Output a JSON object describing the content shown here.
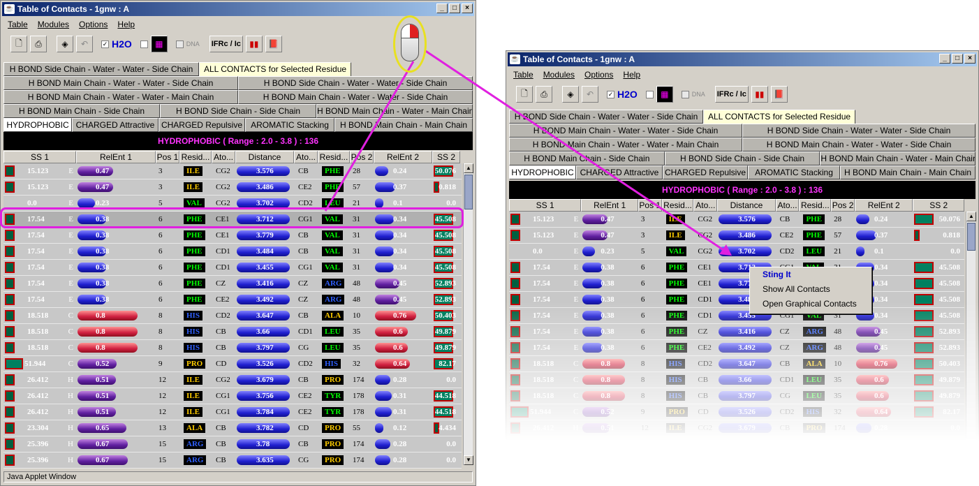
{
  "window": {
    "title": "Table of Contacts - 1gnw : A",
    "app_icon": "java-cup-icon"
  },
  "menu": [
    "Table",
    "Modules",
    "Options",
    "Help"
  ],
  "toolbar": {
    "h2o_label": "H2O",
    "dna_label": "DNA",
    "ifrc_label": "IFRc / Ic"
  },
  "tabs": {
    "row1": [
      "H BOND Side Chain - Water - Water - Side Chain",
      "ALL CONTACTS for Selected Residue"
    ],
    "row2": [
      "H BOND Main Chain - Water - Water - Side Chain",
      "H BOND Side Chain - Water - Water - Side Chain"
    ],
    "row3": [
      "H BOND Main Chain - Water - Water - Main Chain",
      "H BOND Main Chain - Water - Water - Side Chain"
    ],
    "row4": [
      "H BOND Main Chain - Side Chain",
      "H BOND Side Chain - Side Chain",
      "H BOND Main Chain - Water - Main Chain"
    ],
    "row5": [
      "HYDROPHOBIC",
      "CHARGED Attractive",
      "CHARGED Repulsive",
      "AROMATIC Stacking",
      "H BOND Main Chain - Main Chain"
    ]
  },
  "panel_title": "HYDROPHOBIC ( Range :  2.0 - 3.8 ) :  136",
  "columns": [
    "SS 1",
    "RelEnt 1",
    "Pos 1",
    "Resid...",
    "Ato...",
    "Distance",
    "Ato...",
    "Resid...",
    "Pos 2",
    "RelEnt 2",
    "SS 2"
  ],
  "columns_left": [
    "SS 1",
    "RelEnt 1",
    "Pos 1",
    "Resid...",
    "Ato...",
    "Distance",
    "Ato...",
    "Resid...",
    "Pos 2",
    "RelEnt 2",
    "SS 2"
  ],
  "rows": [
    {
      "ss1": "15.123",
      "e": "E",
      "rel1": "0.47",
      "pos1": "3",
      "res1": "ILE",
      "ato1": "CG2",
      "dist": "3.576",
      "ato2": "CB",
      "res2": "PHE",
      "pos2": "28",
      "rel2": "0.24",
      "ss2": "50.076"
    },
    {
      "ss1": "15.123",
      "e": "E",
      "rel1": "0.47",
      "pos1": "3",
      "res1": "ILE",
      "ato1": "CG2",
      "dist": "3.486",
      "ato2": "CE2",
      "res2": "PHE",
      "pos2": "57",
      "rel2": "0.37",
      "ss2": "0.818"
    },
    {
      "ss1": "0.0",
      "e": "E",
      "rel1": "0.23",
      "pos1": "5",
      "res1": "VAL",
      "ato1": "CG2",
      "dist": "3.702",
      "ato2": "CD2",
      "res2": "LEU",
      "pos2": "21",
      "rel2": "0.1",
      "ss2": "0.0"
    },
    {
      "ss1": "17.54",
      "e": "E",
      "rel1": "0.38",
      "pos1": "6",
      "res1": "PHE",
      "ato1": "CE1",
      "dist": "3.712",
      "ato2": "CG1",
      "res2": "VAL",
      "pos2": "31",
      "rel2": "0.34",
      "ss2": "45.508"
    },
    {
      "ss1": "17.54",
      "e": "E",
      "rel1": "0.38",
      "pos1": "6",
      "res1": "PHE",
      "ato1": "CE1",
      "dist": "3.779",
      "ato2": "CB",
      "res2": "VAL",
      "pos2": "31",
      "rel2": "0.34",
      "ss2": "45.508"
    },
    {
      "ss1": "17.54",
      "e": "E",
      "rel1": "0.38",
      "pos1": "6",
      "res1": "PHE",
      "ato1": "CD1",
      "dist": "3.484",
      "ato2": "CB",
      "res2": "VAL",
      "pos2": "31",
      "rel2": "0.34",
      "ss2": "45.508"
    },
    {
      "ss1": "17.54",
      "e": "E",
      "rel1": "0.38",
      "pos1": "6",
      "res1": "PHE",
      "ato1": "CD1",
      "dist": "3.455",
      "ato2": "CG1",
      "res2": "VAL",
      "pos2": "31",
      "rel2": "0.34",
      "ss2": "45.508"
    },
    {
      "ss1": "17.54",
      "e": "E",
      "rel1": "0.38",
      "pos1": "6",
      "res1": "PHE",
      "ato1": "CZ",
      "dist": "3.416",
      "ato2": "CZ",
      "res2": "ARG",
      "pos2": "48",
      "rel2": "0.45",
      "ss2": "52.893"
    },
    {
      "ss1": "17.54",
      "e": "E",
      "rel1": "0.38",
      "pos1": "6",
      "res1": "PHE",
      "ato1": "CE2",
      "dist": "3.492",
      "ato2": "CZ",
      "res2": "ARG",
      "pos2": "48",
      "rel2": "0.45",
      "ss2": "52.893"
    },
    {
      "ss1": "18.518",
      "e": "C",
      "rel1": "0.8",
      "pos1": "8",
      "res1": "HIS",
      "ato1": "CD2",
      "dist": "3.647",
      "ato2": "CB",
      "res2": "ALA",
      "pos2": "10",
      "rel2": "0.76",
      "ss2": "50.403"
    },
    {
      "ss1": "18.518",
      "e": "C",
      "rel1": "0.8",
      "pos1": "8",
      "res1": "HIS",
      "ato1": "CB",
      "dist": "3.66",
      "ato2": "CD1",
      "res2": "LEU",
      "pos2": "35",
      "rel2": "0.6",
      "ss2": "49.879"
    },
    {
      "ss1": "18.518",
      "e": "C",
      "rel1": "0.8",
      "pos1": "8",
      "res1": "HIS",
      "ato1": "CB",
      "dist": "3.797",
      "ato2": "CG",
      "res2": "LEU",
      "pos2": "35",
      "rel2": "0.6",
      "ss2": "49.879"
    },
    {
      "ss1": "51.944",
      "e": "C",
      "rel1": "0.52",
      "pos1": "9",
      "res1": "PRO",
      "ato1": "CD",
      "dist": "3.526",
      "ato2": "CD2",
      "res2": "HIS",
      "pos2": "32",
      "rel2": "0.64",
      "ss2": "82.17"
    },
    {
      "ss1": "26.412",
      "e": "H",
      "rel1": "0.51",
      "pos1": "12",
      "res1": "ILE",
      "ato1": "CG2",
      "dist": "3.679",
      "ato2": "CB",
      "res2": "PRO",
      "pos2": "174",
      "rel2": "0.28",
      "ss2": "0.0"
    },
    {
      "ss1": "26.412",
      "e": "H",
      "rel1": "0.51",
      "pos1": "12",
      "res1": "ILE",
      "ato1": "CG1",
      "dist": "3.756",
      "ato2": "CE2",
      "res2": "TYR",
      "pos2": "178",
      "rel2": "0.31",
      "ss2": "44.518"
    },
    {
      "ss1": "26.412",
      "e": "H",
      "rel1": "0.51",
      "pos1": "12",
      "res1": "ILE",
      "ato1": "CG1",
      "dist": "3.784",
      "ato2": "CE2",
      "res2": "TYR",
      "pos2": "178",
      "rel2": "0.31",
      "ss2": "44.518"
    },
    {
      "ss1": "23.304",
      "e": "H",
      "rel1": "0.65",
      "pos1": "13",
      "res1": "ALA",
      "ato1": "CB",
      "dist": "3.782",
      "ato2": "CD",
      "res2": "PRO",
      "pos2": "55",
      "rel2": "0.12",
      "ss2": "4.434"
    },
    {
      "ss1": "25.396",
      "e": "H",
      "rel1": "0.67",
      "pos1": "15",
      "res1": "ARG",
      "ato1": "CB",
      "dist": "3.78",
      "ato2": "CB",
      "res2": "PRO",
      "pos2": "174",
      "rel2": "0.28",
      "ss2": "0.0"
    },
    {
      "ss1": "25.396",
      "e": "H",
      "rel1": "0.67",
      "pos1": "15",
      "res1": "ARG",
      "ato1": "CB",
      "dist": "3.635",
      "ato2": "CG",
      "res2": "PRO",
      "pos2": "174",
      "rel2": "0.28",
      "ss2": "0.0"
    }
  ],
  "status": "Java Applet Window",
  "context_menu": [
    "Sting It",
    "Show All Contacts",
    "Open Graphical Contacts"
  ],
  "colors": {
    "accent": "#e020e0",
    "title_bg": "#0a246a",
    "panel_fg": "#ff33ff"
  }
}
